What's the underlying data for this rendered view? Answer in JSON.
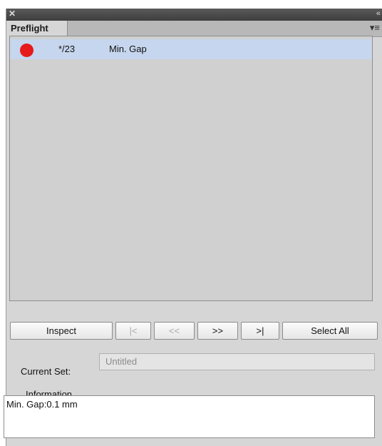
{
  "window": {
    "close_glyph": "✕",
    "collapse_glyph": "«",
    "menu_glyph": "▾≡"
  },
  "tab": {
    "label": "Preflight"
  },
  "list": {
    "items": [
      {
        "status_color": "#e61a1a",
        "page": "*/23",
        "label": "Min. Gap"
      }
    ]
  },
  "buttons": {
    "inspect": "Inspect",
    "first": "|<",
    "prev": "<<",
    "next": ">>",
    "last": ">|",
    "select_all": "Select All"
  },
  "current_set": {
    "label": "Current Set:",
    "value": "Untitled"
  },
  "information": {
    "label": "Information",
    "text": "Min. Gap:0.1 mm"
  }
}
